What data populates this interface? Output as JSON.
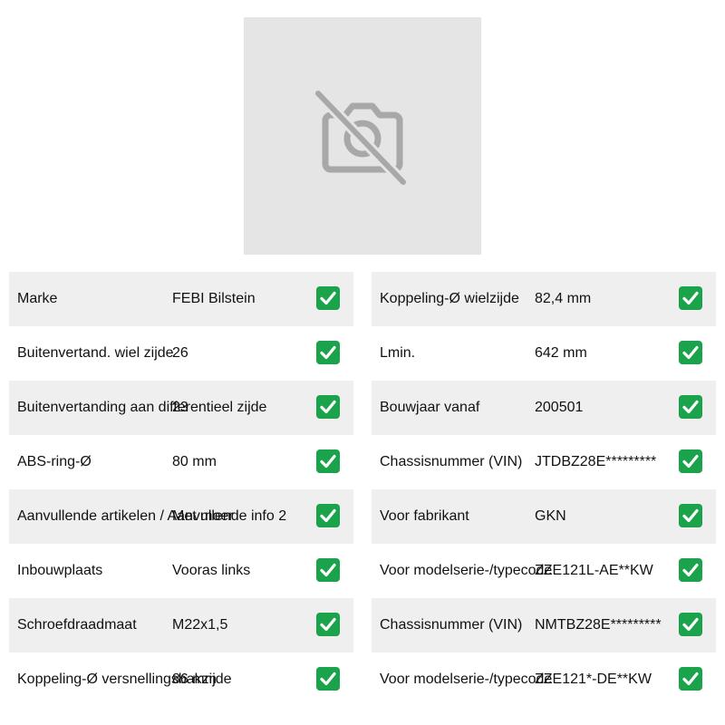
{
  "image": {
    "icon": "camera-off-icon"
  },
  "colors": {
    "check_green": "#1aa34a",
    "row_shade": "#efefef",
    "photo_bg": "#e5e5e5"
  },
  "left_table": [
    {
      "label": "Marke",
      "value": "FEBI Bilstein"
    },
    {
      "label": "Buitenvertand. wiel zijde",
      "value": "26"
    },
    {
      "label": "Buitenvertanding aan differentieel zijde",
      "value": "23"
    },
    {
      "label": "ABS-ring-Ø",
      "value": "80 mm"
    },
    {
      "label": "Aanvullende artikelen / Aanvullende info 2",
      "value": "Met moer"
    },
    {
      "label": "Inbouwplaats",
      "value": "Vooras links"
    },
    {
      "label": "Schroefdraadmaat",
      "value": "M22x1,5"
    },
    {
      "label": "Koppeling-Ø versnellingsbakzijde",
      "value": "86 mm"
    }
  ],
  "right_table": [
    {
      "label": "Koppeling-Ø wielzijde",
      "value": "82,4 mm"
    },
    {
      "label": "Lmin.",
      "value": "642 mm"
    },
    {
      "label": "Bouwjaar vanaf",
      "value": "200501"
    },
    {
      "label": "Chassisnummer (VIN)",
      "value": "JTDBZ28E*********"
    },
    {
      "label": "Voor fabrikant",
      "value": "GKN"
    },
    {
      "label": "Voor modelserie-/typecode",
      "value": "ZZE121L-AE**KW"
    },
    {
      "label": "Chassisnummer (VIN)",
      "value": "NMTBZ28E*********"
    },
    {
      "label": "Voor modelserie-/typecode",
      "value": "ZZE121*-DE**KW"
    }
  ]
}
